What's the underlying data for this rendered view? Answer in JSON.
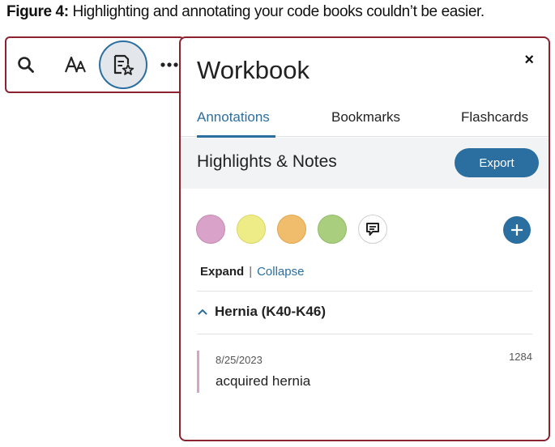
{
  "caption": {
    "figure": "Figure 4:",
    "text": "Highlighting and annotating your code books couldn’t be easier."
  },
  "toolbar": {
    "icons": [
      "search-icon",
      "font-size-icon",
      "workbook-icon",
      "more-icon"
    ],
    "active": "workbook"
  },
  "panel": {
    "title": "Workbook",
    "close": "×",
    "tabs": [
      "Annotations",
      "Bookmarks",
      "Flashcards"
    ],
    "active_tab": "Annotations",
    "section_title": "Highlights & Notes",
    "export_label": "Export",
    "colors": {
      "accent": "#2b6fa0",
      "frame": "#8b2230",
      "highlight_pink": "#d9a2c8",
      "highlight_yellow": "#eeec86",
      "highlight_orange": "#f0bd6c",
      "highlight_green": "#a9cf7e"
    },
    "expand_label": "Expand",
    "separator": "|",
    "collapse_label": "Collapse",
    "group": {
      "title": "Hernia (K40-K46)",
      "expanded": true
    },
    "notes": [
      {
        "date": "8/25/2023",
        "number": "1284",
        "text": "acquired hernia",
        "color": "#d9a2c8"
      }
    ]
  }
}
